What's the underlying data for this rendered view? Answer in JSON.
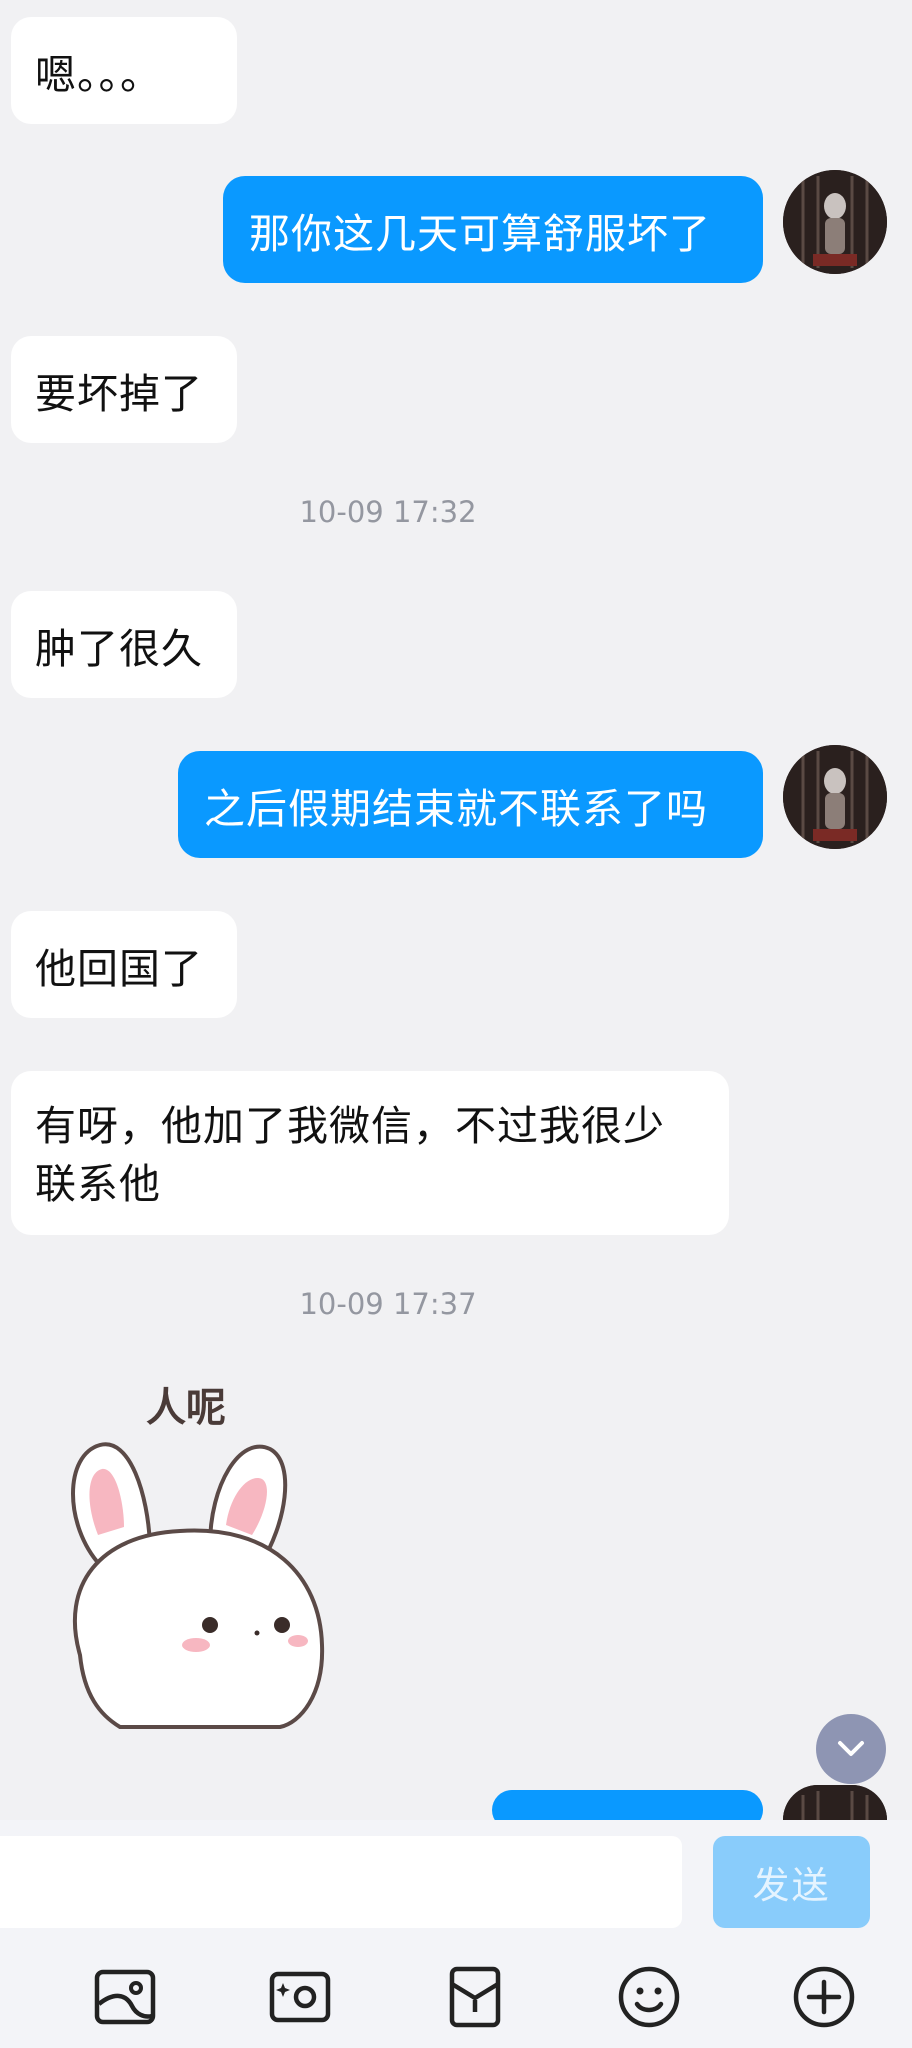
{
  "messages": [
    {
      "side": "in",
      "text": "嗯。。。"
    },
    {
      "side": "out",
      "text": "那你这几天可算舒服坏了"
    },
    {
      "side": "in",
      "text": "要坏掉了"
    },
    {
      "side": "in",
      "text": "肿了很久"
    },
    {
      "side": "out",
      "text": "之后假期结束就不联系了吗"
    },
    {
      "side": "in",
      "text": "他回国了"
    },
    {
      "side": "in",
      "text": "有呀，他加了我微信，不过我很少联系他"
    }
  ],
  "timestamps": [
    "10-09 17:32",
    "10-09 17:37"
  ],
  "sticker": {
    "caption": "人呢"
  },
  "composer": {
    "input_value": "",
    "send_label": "发送"
  },
  "toolbar_icons": [
    "image-icon",
    "camera-icon",
    "red-packet-icon",
    "emoji-icon",
    "add-icon"
  ],
  "colors": {
    "outgoing_bubble": "#0a99ff",
    "background": "#f1f1f3",
    "send_disabled": "#89ccfb"
  }
}
